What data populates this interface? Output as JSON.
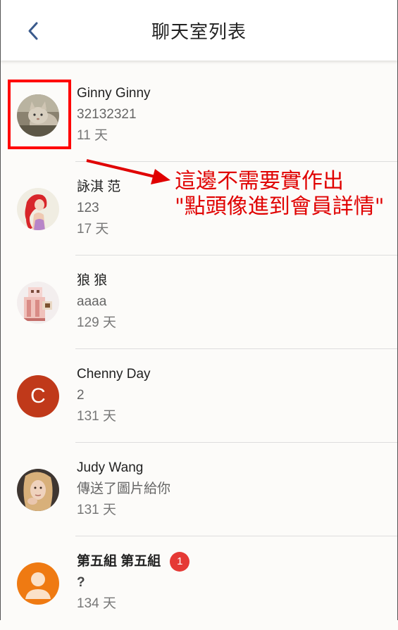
{
  "header": {
    "title": "聊天室列表",
    "back_icon": "chevron-left-icon",
    "back_color": "#3a5a8c"
  },
  "chats": [
    {
      "name": "Ginny Ginny",
      "last_message": "32132321",
      "time": "11 天",
      "avatar": "cat-photo",
      "unread": null,
      "bold": false
    },
    {
      "name": "詠淇 范",
      "last_message": "123",
      "time": "17 天",
      "avatar": "mermaid-illustration",
      "unread": null,
      "bold": false
    },
    {
      "name": "狼 狼",
      "last_message": "aaaa",
      "time": "129 天",
      "avatar": "pixel-block-figure",
      "unread": null,
      "bold": false
    },
    {
      "name": "Chenny Day",
      "last_message": "2",
      "time": "131 天",
      "avatar_letter": "C",
      "avatar_color": "#c0391a",
      "unread": null,
      "bold": false
    },
    {
      "name": "Judy Wang",
      "last_message": "傳送了圖片給你",
      "time": "131 天",
      "avatar": "portrait-photo",
      "unread": null,
      "bold": false
    },
    {
      "name": "第五組 第五組",
      "last_message": "?",
      "time": "134 天",
      "avatar": "default-person-icon",
      "avatar_color": "#ef7a12",
      "unread": "1",
      "bold": true
    }
  ],
  "annotation": {
    "line1": "這邊不需要實作出",
    "line2": "\"點頭像進到會員詳情\"",
    "color": "#e00000"
  }
}
